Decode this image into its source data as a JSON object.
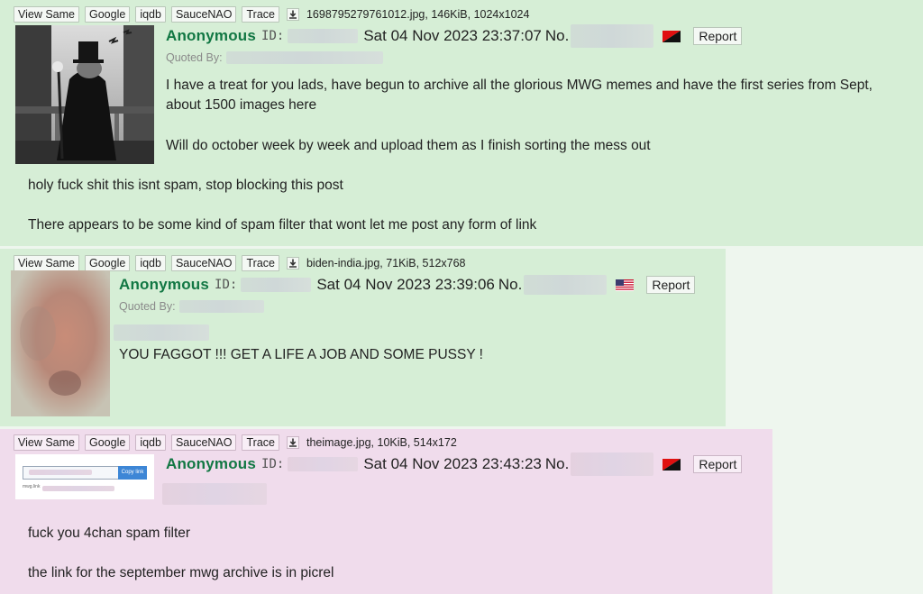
{
  "toolbar_labels": {
    "view_same": "View Same",
    "google": "Google",
    "iqdb": "iqdb",
    "saucenao": "SauceNAO",
    "trace": "Trace"
  },
  "posts": [
    {
      "file_info": "1698795279761012.jpg, 146KiB, 1024x1024",
      "name": "Anonymous",
      "id_label": "ID:",
      "date": "Sat 04 Nov 2023 23:37:07",
      "no_label": "No.",
      "flag": "black-red-diagonal-flag",
      "report_label": "Report",
      "quoted_by_label": "Quoted By:",
      "lines": [
        "I have a treat for you lads, have begun to archive all the glorious MWG memes and have the first series from Sept,",
        "about 1500 images here",
        "Will do october week by week and upload them as I finish sorting the mess out",
        "holy fuck shit this isnt spam, stop blocking this post",
        "There appears to be some kind of spam filter that wont let me post any form of link"
      ]
    },
    {
      "file_info": "biden-india.jpg, 71KiB, 512x768",
      "name": "Anonymous",
      "id_label": "ID:",
      "date": "Sat 04 Nov 2023 23:39:06",
      "no_label": "No.",
      "flag": "us-flag",
      "report_label": "Report",
      "quoted_by_label": "Quoted By:",
      "lines": [
        "YOU FAGGOT !!! GET A LIFE A JOB AND SOME PUSSY !"
      ]
    },
    {
      "file_info": "theimage.jpg, 10KiB, 514x172",
      "name": "Anonymous",
      "id_label": "ID:",
      "date": "Sat 04 Nov 2023 23:43:23",
      "no_label": "No.",
      "flag": "black-red-diagonal-flag",
      "report_label": "Report",
      "lines": [
        "fuck you 4chan spam filter",
        "the link for the september mwg archive is in picrel"
      ],
      "thumb_button": "Copy link",
      "thumb_caption": "mwg.link"
    }
  ],
  "colors": {
    "name": "#117743",
    "green_post_bg": "#d6eed6",
    "pink_post_bg": "#f0dcec",
    "page_bg": "#eef6ee"
  }
}
